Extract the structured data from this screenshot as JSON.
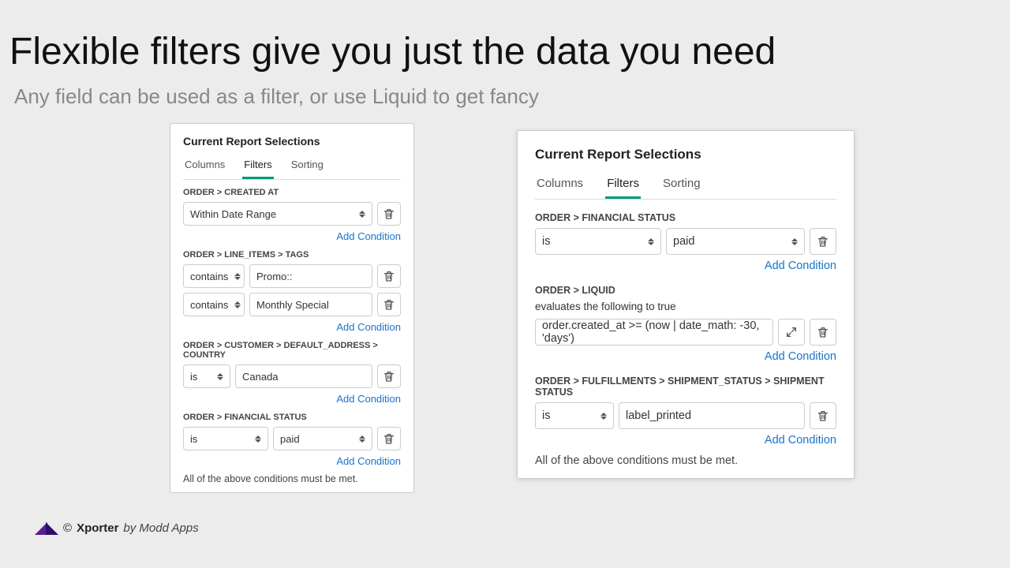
{
  "page": {
    "title": "Flexible filters give you just the data you need",
    "subtitle": "Any field can be used as a filter, or use Liquid to get fancy"
  },
  "ui": {
    "panel_title": "Current Report Selections",
    "tabs": {
      "columns": "Columns",
      "filters": "Filters",
      "sorting": "Sorting"
    },
    "add_condition": "Add Condition",
    "all_must": "All of the above conditions must be met."
  },
  "left": {
    "groups": [
      {
        "label": "ORDER > CREATED AT",
        "rows": [
          {
            "type": "select-full",
            "value": "Within Date Range"
          }
        ]
      },
      {
        "label": "ORDER > LINE_ITEMS > TAGS",
        "rows": [
          {
            "type": "op-input",
            "op": "contains",
            "value": "Promo::"
          },
          {
            "type": "op-input",
            "op": "contains",
            "value": "Monthly Special"
          }
        ]
      },
      {
        "label": "ORDER > CUSTOMER > DEFAULT_ADDRESS > COUNTRY",
        "rows": [
          {
            "type": "op-input-narrow",
            "op": "is",
            "value": "Canada"
          }
        ]
      },
      {
        "label": "ORDER > FINANCIAL STATUS",
        "rows": [
          {
            "type": "op-select",
            "op": "is",
            "value": "paid"
          }
        ]
      }
    ]
  },
  "right": {
    "fin": {
      "label": "ORDER > FINANCIAL STATUS",
      "op": "is",
      "value": "paid"
    },
    "liquid": {
      "label": "ORDER > LIQUID",
      "desc": "evaluates the following to true",
      "expr": "order.created_at >= (now | date_math: -30, 'days')"
    },
    "ship": {
      "label": "ORDER > FULFILLMENTS > SHIPMENT_STATUS > SHIPMENT STATUS",
      "op": "is",
      "value": "label_printed"
    }
  },
  "footer": {
    "copyright": "©",
    "product": "Xporter",
    "by": "by Modd Apps"
  }
}
